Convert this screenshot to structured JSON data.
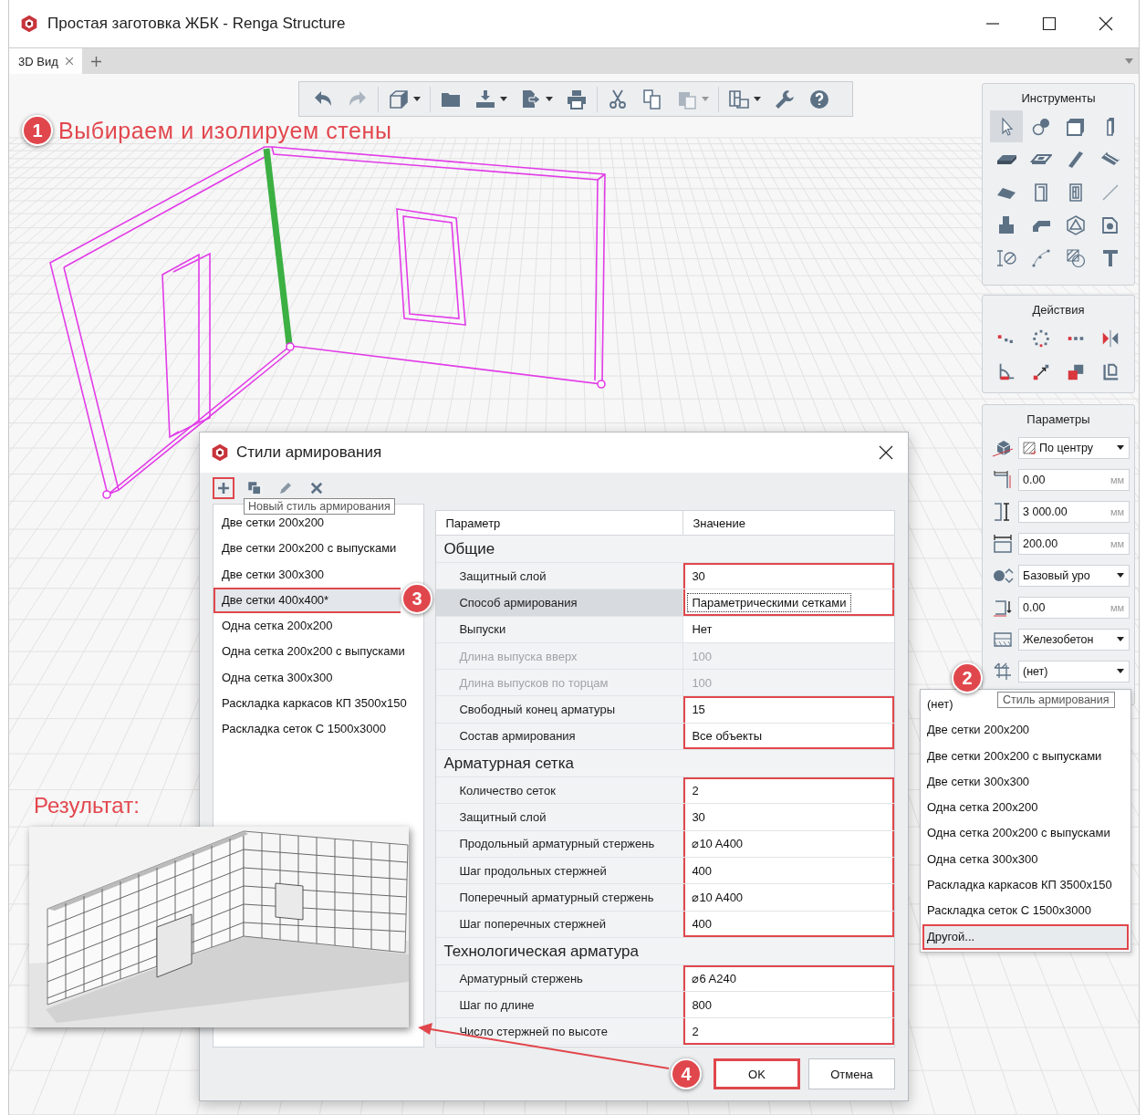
{
  "window": {
    "title": "Простая заготовка ЖБК - Renga Structure"
  },
  "tabs": [
    {
      "label": "3D Вид",
      "selected": true
    }
  ],
  "toolbar": [
    {
      "items": [
        {
          "kind": "undo",
          "disabled": false,
          "menu": false
        },
        {
          "kind": "redo",
          "disabled": true,
          "menu": false
        }
      ]
    },
    {
      "items": [
        {
          "kind": "cube",
          "disabled": false,
          "menu": true
        }
      ]
    },
    {
      "items": [
        {
          "kind": "folder",
          "disabled": false,
          "menu": false
        },
        {
          "kind": "import",
          "disabled": false,
          "menu": true
        },
        {
          "kind": "export",
          "disabled": false,
          "menu": true
        },
        {
          "kind": "print",
          "disabled": false,
          "menu": false
        }
      ]
    },
    {
      "items": [
        {
          "kind": "cut",
          "disabled": false,
          "menu": false
        },
        {
          "kind": "copy",
          "disabled": false,
          "menu": false
        },
        {
          "kind": "paste",
          "disabled": true,
          "menu": true
        }
      ]
    },
    {
      "items": [
        {
          "kind": "layout",
          "disabled": false,
          "menu": true
        },
        {
          "kind": "wrench",
          "disabled": false,
          "menu": false
        },
        {
          "kind": "help",
          "disabled": false,
          "menu": false
        }
      ]
    }
  ],
  "annotations": {
    "heading": "Выбираем и изолируем стены",
    "result_label": "Результат:",
    "steps": [
      "1",
      "2",
      "3",
      "4"
    ]
  },
  "tools_panel": {
    "title": "Инструменты",
    "tools": [
      {
        "kind": "pointer",
        "selected": true
      },
      {
        "kind": "symbol",
        "selected": false
      },
      {
        "kind": "wall",
        "selected": false
      },
      {
        "kind": "column",
        "selected": false
      },
      {
        "kind": "slab",
        "selected": false
      },
      {
        "kind": "opening",
        "selected": false
      },
      {
        "kind": "beam",
        "selected": false
      },
      {
        "kind": "ribbed",
        "selected": false
      },
      {
        "kind": "roof",
        "selected": false
      },
      {
        "kind": "door",
        "selected": false
      },
      {
        "kind": "window",
        "selected": false
      },
      {
        "kind": "line",
        "selected": false
      },
      {
        "kind": "foundation",
        "selected": false
      },
      {
        "kind": "bent",
        "selected": false
      },
      {
        "kind": "polyhedron",
        "selected": false
      },
      {
        "kind": "equipment",
        "selected": false
      },
      {
        "kind": "dimension",
        "selected": false
      },
      {
        "kind": "curve",
        "selected": false
      },
      {
        "kind": "hatch",
        "selected": false
      },
      {
        "kind": "text",
        "selected": false
      }
    ]
  },
  "actions_panel": {
    "title": "Действия",
    "actions": [
      {
        "kind": "move"
      },
      {
        "kind": "rotate"
      },
      {
        "kind": "array"
      },
      {
        "kind": "mirror"
      },
      {
        "kind": "angle"
      },
      {
        "kind": "stretch"
      },
      {
        "kind": "overlap"
      },
      {
        "kind": "corner"
      }
    ]
  },
  "parameters_panel": {
    "title": "Параметры",
    "rows": [
      {
        "kind": "select",
        "value": "По центру",
        "swatch": true
      },
      {
        "kind": "input",
        "value": "0.00",
        "unit": "мм"
      },
      {
        "kind": "input",
        "value": "3 000.00",
        "unit": "мм"
      },
      {
        "kind": "input",
        "value": "200.00",
        "unit": "мм"
      },
      {
        "kind": "select",
        "value": "Базовый уро",
        "swatch": false
      },
      {
        "kind": "input",
        "value": "0.00",
        "unit": "мм"
      },
      {
        "kind": "select",
        "value": "Железобетон",
        "swatch": false
      },
      {
        "kind": "select",
        "value": "(нет)",
        "swatch": false
      }
    ]
  },
  "dropdown": {
    "tooltip": "Стиль армирования",
    "items": [
      {
        "label": "(нет)",
        "selected": false
      },
      {
        "label": "Две сетки 200x200",
        "selected": false
      },
      {
        "label": "Две сетки 200x200 с выпусками",
        "selected": false
      },
      {
        "label": "Две сетки 300x300",
        "selected": false
      },
      {
        "label": "Одна сетка 200x200",
        "selected": false
      },
      {
        "label": "Одна сетка 200x200 с выпусками",
        "selected": false
      },
      {
        "label": "Одна сетка 300x300",
        "selected": false
      },
      {
        "label": "Раскладка каркасов КП 3500x150",
        "selected": false
      },
      {
        "label": "Раскладка сеток С 1500x3000",
        "selected": false
      },
      {
        "label": "Другой...",
        "selected": true
      }
    ]
  },
  "dialog": {
    "title": "Стили армирования",
    "tooltip": "Новый стиль армирования",
    "toolbar": [
      {
        "kind": "add",
        "highlighted": true
      },
      {
        "kind": "duplicate",
        "highlighted": false
      },
      {
        "kind": "edit",
        "highlighted": false
      },
      {
        "kind": "delete",
        "highlighted": false
      }
    ],
    "styles": [
      {
        "label": "Две сетки 200x200",
        "selected": false
      },
      {
        "label": "Две сетки 200x200 с выпусками",
        "selected": false
      },
      {
        "label": "Две сетки 300x300",
        "selected": false
      },
      {
        "label": "Две сетки 400x400*",
        "selected": true
      },
      {
        "label": "Одна сетка 200x200",
        "selected": false
      },
      {
        "label": "Одна сетка 200x200 с выпусками",
        "selected": false
      },
      {
        "label": "Одна сетка 300x300",
        "selected": false
      },
      {
        "label": "Раскладка каркасов КП 3500x150",
        "selected": false
      },
      {
        "label": "Раскладка сеток С 1500x3000",
        "selected": false
      }
    ],
    "columns": [
      "Параметр",
      "Значение"
    ],
    "groups": [
      {
        "title": "Общие",
        "rows": [
          {
            "name": "Защитный слой",
            "value": "30",
            "disabled": false,
            "selected": false,
            "highlighted": true
          },
          {
            "name": "Способ армирования",
            "value": "Параметрическими сетками",
            "disabled": false,
            "selected": true,
            "highlighted": true
          },
          {
            "name": "Выпуски",
            "value": "Нет",
            "disabled": false,
            "selected": false,
            "highlighted": false
          },
          {
            "name": "Длина выпуска вверх",
            "value": "100",
            "disabled": true,
            "selected": false,
            "highlighted": false
          },
          {
            "name": "Длина выпусков по торцам",
            "value": "100",
            "disabled": true,
            "selected": false,
            "highlighted": false
          },
          {
            "name": "Свободный конец арматуры",
            "value": "15",
            "disabled": false,
            "selected": false,
            "highlighted": true
          },
          {
            "name": "Состав армирования",
            "value": "Все объекты",
            "disabled": false,
            "selected": false,
            "highlighted": true
          }
        ]
      },
      {
        "title": "Арматурная сетка",
        "rows": [
          {
            "name": "Количество сеток",
            "value": "2",
            "disabled": false,
            "selected": false,
            "highlighted": true
          },
          {
            "name": "Защитный слой",
            "value": "30",
            "disabled": false,
            "selected": false,
            "highlighted": true
          },
          {
            "name": "Продольный арматурный стержень",
            "value": "⌀10 A400",
            "disabled": false,
            "selected": false,
            "highlighted": true
          },
          {
            "name": "Шаг продольных стержней",
            "value": "400",
            "disabled": false,
            "selected": false,
            "highlighted": true
          },
          {
            "name": "Поперечный арматурный стержень",
            "value": "⌀10 A400",
            "disabled": false,
            "selected": false,
            "highlighted": true
          },
          {
            "name": "Шаг поперечных стержней",
            "value": "400",
            "disabled": false,
            "selected": false,
            "highlighted": true
          }
        ]
      },
      {
        "title": "Технологическая арматура",
        "rows": [
          {
            "name": "Арматурный стержень",
            "value": "⌀6 A240",
            "disabled": false,
            "selected": false,
            "highlighted": true
          },
          {
            "name": "Шаг по длине",
            "value": "800",
            "disabled": false,
            "selected": false,
            "highlighted": true
          },
          {
            "name": "Число стержней по высоте",
            "value": "2",
            "disabled": false,
            "selected": false,
            "highlighted": true
          }
        ]
      }
    ],
    "buttons": [
      {
        "label": "OK",
        "highlighted": true
      },
      {
        "label": "Отмена",
        "highlighted": false
      }
    ]
  }
}
